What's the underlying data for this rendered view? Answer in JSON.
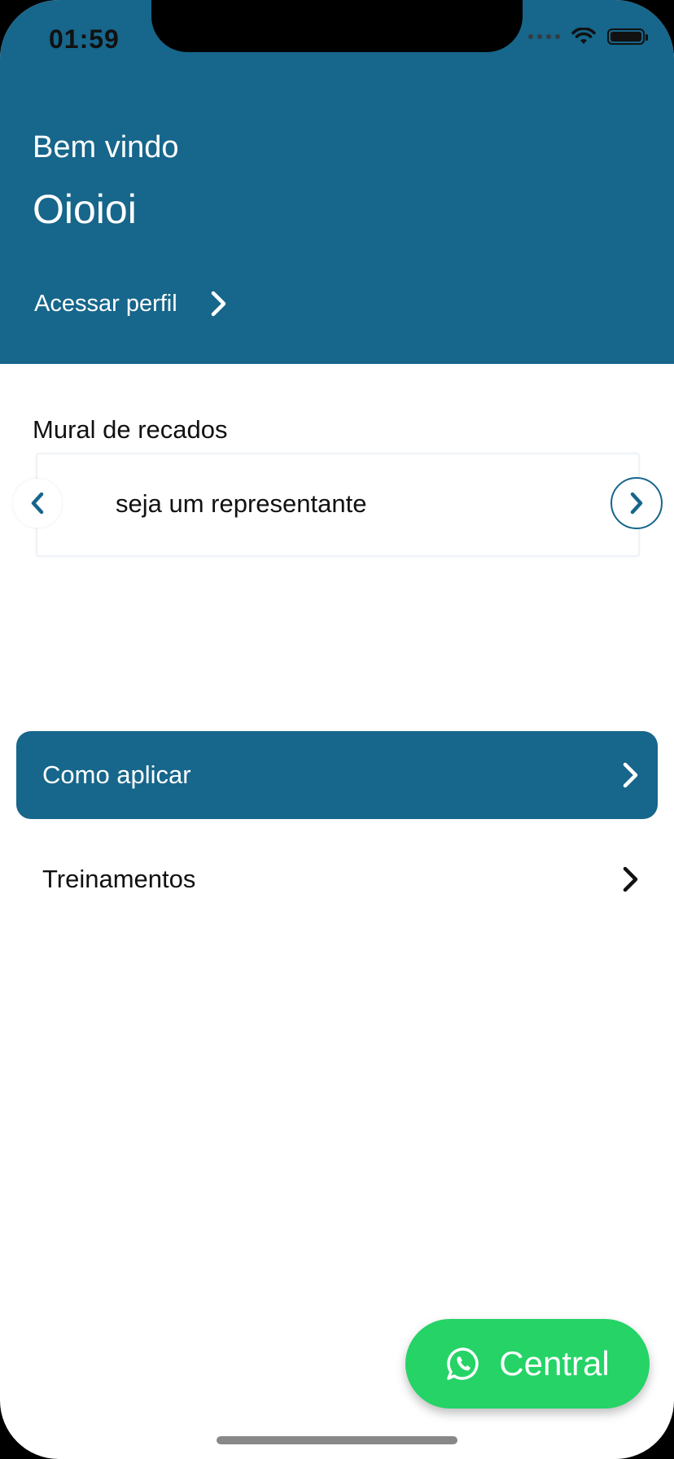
{
  "status_bar": {
    "time": "01:59"
  },
  "header": {
    "greeting": "Bem vindo",
    "username": "Oioioi",
    "profile_link": "Acessar perfil"
  },
  "mural": {
    "title": "Mural de recados",
    "message": "seja um representante"
  },
  "menu": {
    "items": [
      {
        "label": "Como aplicar",
        "active": true
      },
      {
        "label": "Treinamentos",
        "active": false
      }
    ]
  },
  "whatsapp": {
    "label": "Central",
    "icon": "whatsapp-icon"
  },
  "colors": {
    "primary": "#17668b",
    "whatsapp": "#25d366",
    "text": "#111111",
    "background": "#ffffff"
  }
}
